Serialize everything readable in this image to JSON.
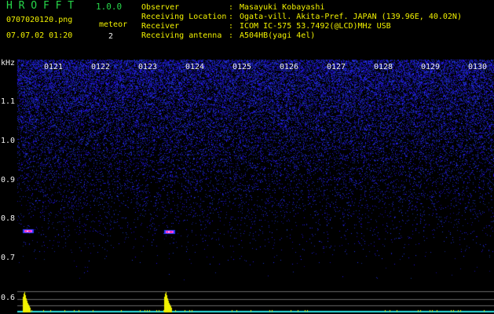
{
  "app": {
    "title": "H R O F F T",
    "version": "1.0.0"
  },
  "file": {
    "name": "0707020120.png",
    "datetime": "07.07.02 01:20"
  },
  "meteor": {
    "label": "meteor",
    "count": "2"
  },
  "info": [
    {
      "key": "Observer",
      "value": "Masayuki Kobayashi"
    },
    {
      "key": "Receiving Location",
      "value": "Ogata-vill. Akita-Pref. JAPAN (139.96E, 40.02N)"
    },
    {
      "key": "Receiver",
      "value": "ICOM IC-575 53.7492(@LCD)MHz USB"
    },
    {
      "key": "Receiving antenna",
      "value": "A504HB(yagi 4el)"
    }
  ],
  "info_separator": ":",
  "axis": {
    "y_unit": "kHz",
    "y_ticks": [
      "1.1",
      "1.0",
      "0.9",
      "0.8",
      "0.7",
      "0.6"
    ],
    "x_ticks": [
      "0121",
      "0122",
      "0123",
      "0124",
      "0125",
      "0126",
      "0127",
      "0128",
      "0129",
      "0130"
    ]
  },
  "colors": {
    "title_green": "#27d84a",
    "label_yellow": "#f2f200",
    "noise_blue": "#2a3cff",
    "echo_red": "#ff3030",
    "echo_magenta": "#ff40ff",
    "bar_yellow": "#f2f200",
    "baseline_cyan": "#30e0e0"
  },
  "meteor_echoes": [
    {
      "minute_offset": 0.05,
      "freq_khz": 0.772
    },
    {
      "minute_offset": 3.05,
      "freq_khz": 0.77
    }
  ]
}
